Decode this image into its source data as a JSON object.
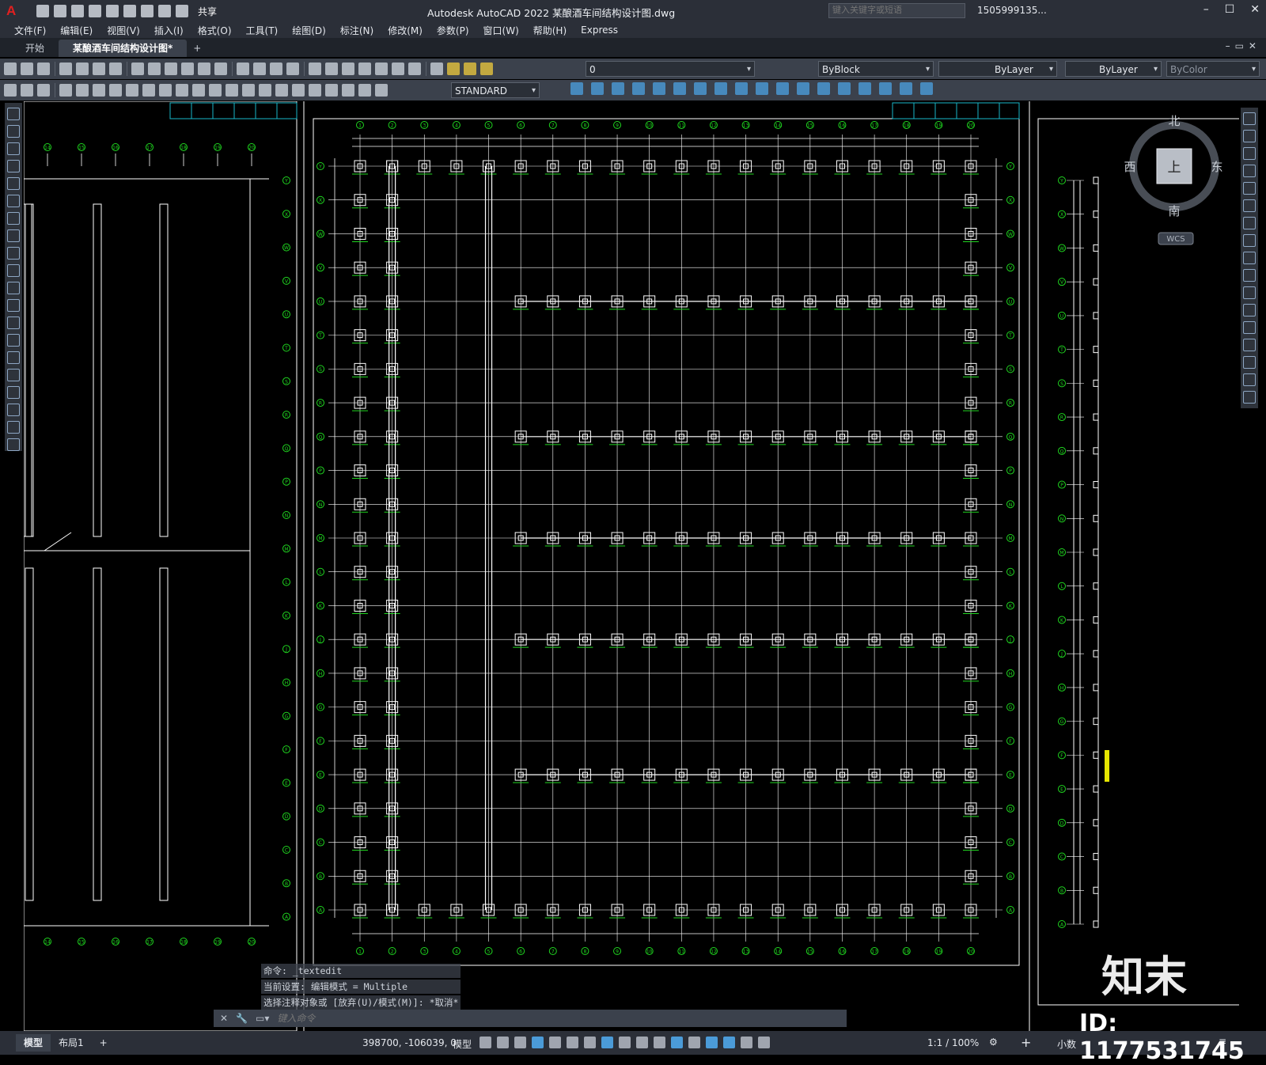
{
  "titlebar": {
    "app_title": "Autodesk AutoCAD 2022    某酿酒车间结构设计图.dwg",
    "share": "共享",
    "search_placeholder": "键入关键字或短语",
    "user": "1505999135..."
  },
  "menu": [
    "文件(F)",
    "编辑(E)",
    "视图(V)",
    "插入(I)",
    "格式(O)",
    "工具(T)",
    "绘图(D)",
    "标注(N)",
    "修改(M)",
    "参数(P)",
    "窗口(W)",
    "帮助(H)",
    "Express"
  ],
  "tabs": {
    "start": "开始",
    "document": "某酿酒车间结构设计图*",
    "add": "+"
  },
  "toolbar": {
    "layer_current": "0",
    "color": "ByBlock",
    "linetype": "ByLayer",
    "lineweight": "ByLayer",
    "plotstyle": "ByColor",
    "text_style": "STANDARD"
  },
  "viewcube": {
    "north": "北",
    "south": "南",
    "east": "东",
    "west": "西",
    "top": "上",
    "wcs": "WCS"
  },
  "command": {
    "history": [
      "命令:  _textedit",
      "当前设置: 编辑模式 = Multiple",
      "选择注释对象或 [放弃(U)/模式(M)]: *取消*"
    ],
    "placeholder": "键入命令"
  },
  "status": {
    "layout_tabs": [
      "模型",
      "布局1",
      "+"
    ],
    "coords": "398700, -106039, 0",
    "model": "模型",
    "scale": "1:1 / 100%",
    "units": "小数"
  },
  "watermark": {
    "brand": "知末",
    "id": "ID: 1177531745"
  },
  "drawing": {
    "grid_cols": [
      "1",
      "2",
      "3",
      "4",
      "5",
      "6",
      "7",
      "8",
      "9",
      "10",
      "11",
      "12",
      "13",
      "14",
      "15",
      "16",
      "17",
      "18",
      "19",
      "20"
    ],
    "grid_rows": [
      "Y",
      "X",
      "W",
      "V",
      "U",
      "T",
      "S",
      "R",
      "Q",
      "P",
      "N",
      "M",
      "L",
      "K",
      "J",
      "H",
      "G",
      "F",
      "E",
      "D",
      "C",
      "B",
      "A"
    ],
    "left_cols": [
      "14",
      "15",
      "16",
      "17",
      "18",
      "19",
      "20"
    ]
  },
  "colors": {
    "line": "#ffffff",
    "accent_green": "#1fd61f",
    "accent_cyan": "#18b6c8",
    "accent_yellow": "#e6e600",
    "bg": "#000000"
  }
}
